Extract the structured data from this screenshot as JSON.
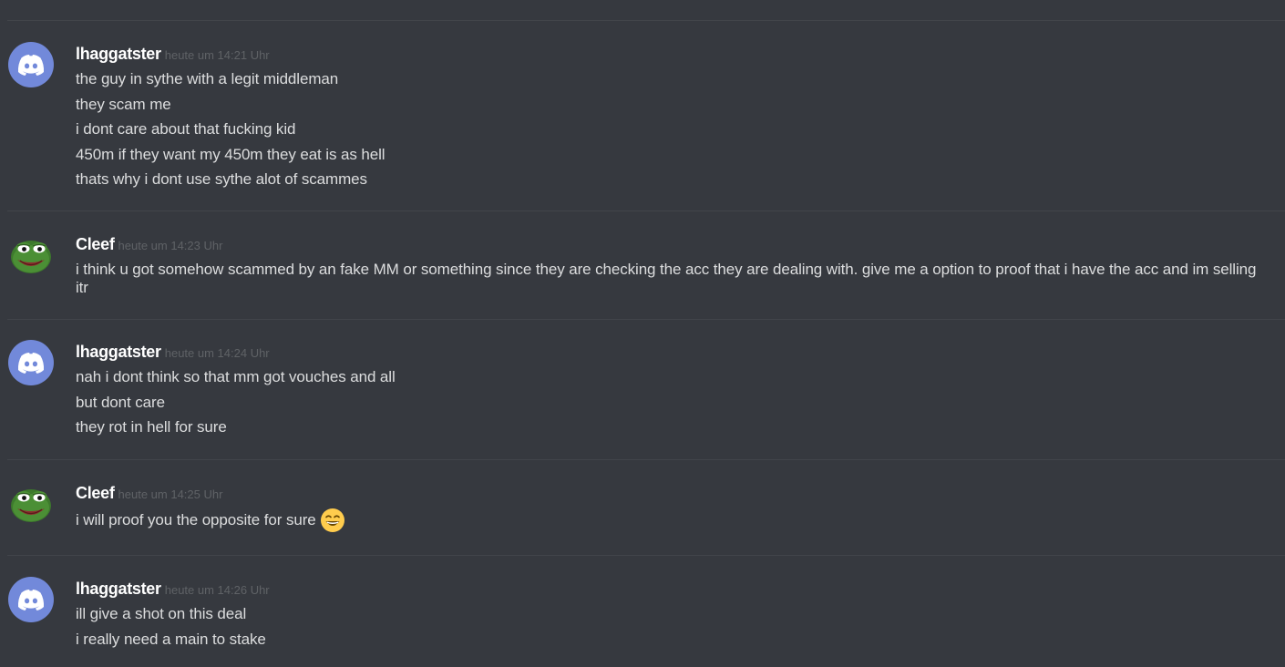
{
  "messages": [
    {
      "username": "lhaggatster",
      "timestamp": "heute um 14:21 Uhr",
      "avatar": "discord-logo-icon",
      "lines": [
        "the guy in sythe with a legit middleman",
        "they scam me",
        "i dont care about that fucking kid",
        "450m if they want my 450m they eat is as hell",
        "thats why i dont use sythe alot of scammes"
      ]
    },
    {
      "username": "Cleef",
      "timestamp": "heute um 14:23 Uhr",
      "avatar": "pepe-frog-icon",
      "lines": [
        "i think u got somehow scammed by an fake MM or something since they are checking the acc they are dealing with. give me a option to proof that i have the acc and im selling itr"
      ]
    },
    {
      "username": "lhaggatster",
      "timestamp": "heute um 14:24 Uhr",
      "avatar": "discord-logo-icon",
      "lines": [
        "nah i dont think so that mm got vouches and all",
        "but dont care",
        "they rot in hell for sure"
      ]
    },
    {
      "username": "Cleef",
      "timestamp": "heute um 14:25 Uhr",
      "avatar": "pepe-frog-icon",
      "lines": [
        "i will proof you the opposite for sure"
      ],
      "emoji": "grinning-face-icon"
    },
    {
      "username": "lhaggatster",
      "timestamp": "heute um 14:26 Uhr",
      "avatar": "discord-logo-icon",
      "lines": [
        "ill give a shot on this deal",
        "i really need a main to stake"
      ]
    }
  ],
  "colors": {
    "background": "#36393f",
    "divider": "#42454a",
    "username": "#ffffff",
    "timestamp": "#5f6266",
    "message_text": "#dcddde",
    "discord_blurple": "#7289da"
  }
}
